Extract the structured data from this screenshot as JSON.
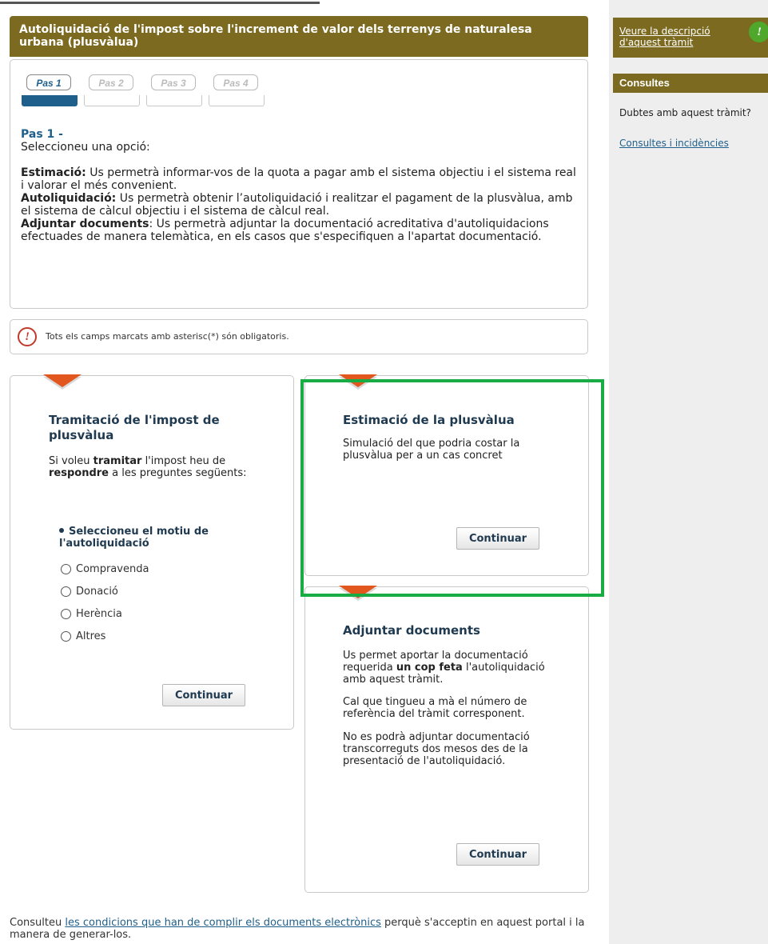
{
  "header": {
    "title": "Autoliquidació de l'impost sobre l'increment de valor dels terrenys de naturalesa urbana (plusvàlua)"
  },
  "steps": {
    "items": [
      "Pas 1",
      "Pas 2",
      "Pas 3",
      "Pas 4"
    ],
    "active_index": 0
  },
  "intro": {
    "step_label": "Pas 1 -",
    "prompt": "Seleccioneu una opció:",
    "estimacio_term": "Estimació:",
    "estimacio_text": " Us permetrà informar-vos de la quota a pagar amb el sistema objectiu i el sistema real i valorar el més convenient.",
    "autoliq_term": "Autoliquidació:",
    "autoliq_text": " Us permetrà obtenir l’autoliquidació i realitzar el pagament de la plusvàlua, amb el sistema de càlcul objectiu i el sistema de càlcul real.",
    "adjuntar_term": "Adjuntar documents",
    "adjuntar_text": ": Us permetrà adjuntar la documentació acreditativa d'autoliquidacions efectuades de manera telemàtica, en els casos que s'especifiquen a l'apartat documentació."
  },
  "notice": {
    "icon": "exclamation-icon",
    "text": "Tots els camps marcats amb asterisc(*) són obligatoris."
  },
  "card_tramitacio": {
    "title": "Tramitació de l'impost de plusvàlua",
    "desc_1": "Si voleu ",
    "desc_bold_1": "tramitar",
    "desc_2": " l'impost heu de ",
    "desc_bold_2": "respondre",
    "desc_3": " a les preguntes següents:",
    "question": "Seleccioneu el motiu de l'autoliquidació",
    "options": [
      "Compravenda",
      "Donació",
      "Herència",
      "Altres"
    ],
    "button": "Continuar"
  },
  "card_estimacio": {
    "title": "Estimació de la plusvàlua",
    "desc": "Simulació del que podria costar la plusvàlua per a un cas concret",
    "button": "Continuar"
  },
  "card_adjuntar": {
    "title": "Adjuntar documents",
    "desc_1a": "Us permet aportar la documentació requerida ",
    "desc_1b": "un cop feta",
    "desc_1c": " l'autoliquidació amb aquest tràmit.",
    "desc_2": "Cal que tingueu a mà el número de referència del tràmit corresponent.",
    "desc_3": "No es podrà adjuntar documentació transcorreguts dos mesos des de la presentació de l'autoliquidació.",
    "button": "Continuar"
  },
  "footer": {
    "pre": "Consulteu ",
    "link": "les condicions que han de complir els documents electrònics",
    "post": " perquè s'acceptin en aquest portal i la manera de generar-los."
  },
  "sidebar": {
    "description_link": "Veure la descripció d'aquest tràmit",
    "info_icon": "info-icon",
    "consultes_title": "Consultes",
    "question": "Dubtes amb aquest tràmit?",
    "incidencies_link": "Consultes i incidències"
  },
  "colors": {
    "header_bg": "#7b6a1f",
    "accent_blue": "#1f5f8b",
    "highlight_green": "#1aac44",
    "flag_orange": "#e2571e",
    "info_green": "#4fa82c"
  }
}
